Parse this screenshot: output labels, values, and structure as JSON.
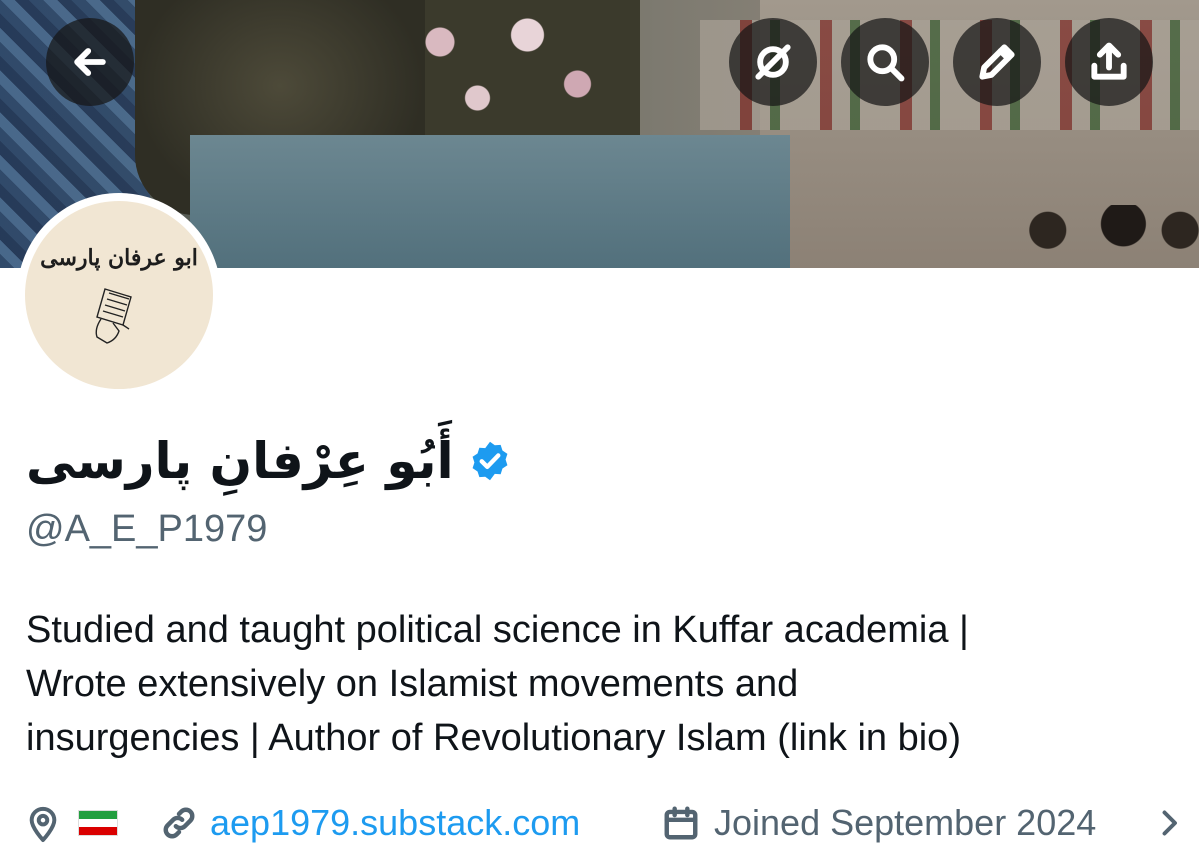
{
  "profile": {
    "display_name": "أَبُو عِرْفانِ پارسی",
    "handle": "@A_E_P1979",
    "verified": true,
    "avatar_text": "ابو عرفان پارسی",
    "bio_lines": [
      "Studied and taught political science in Kuffar academia |",
      "Wrote extensively on Islamist movements and",
      "insurgencies | Author of Revolutionary Islam (link in bio)"
    ],
    "location_flag": "iran-flag",
    "website": "aep1979.substack.com",
    "joined": "Joined September 2024"
  },
  "colors": {
    "link": "#1d9bf0",
    "verified": "#1d9bf0",
    "secondary_text": "#536471",
    "primary_text": "#0f1419"
  },
  "icons": {
    "back": "arrow-left-icon",
    "translate": "no-translate-icon",
    "search": "search-icon",
    "edit": "pencil-icon",
    "share": "share-icon",
    "location": "location-pin-icon",
    "link": "link-icon",
    "calendar": "calendar-icon",
    "chevron": "chevron-right-icon"
  }
}
